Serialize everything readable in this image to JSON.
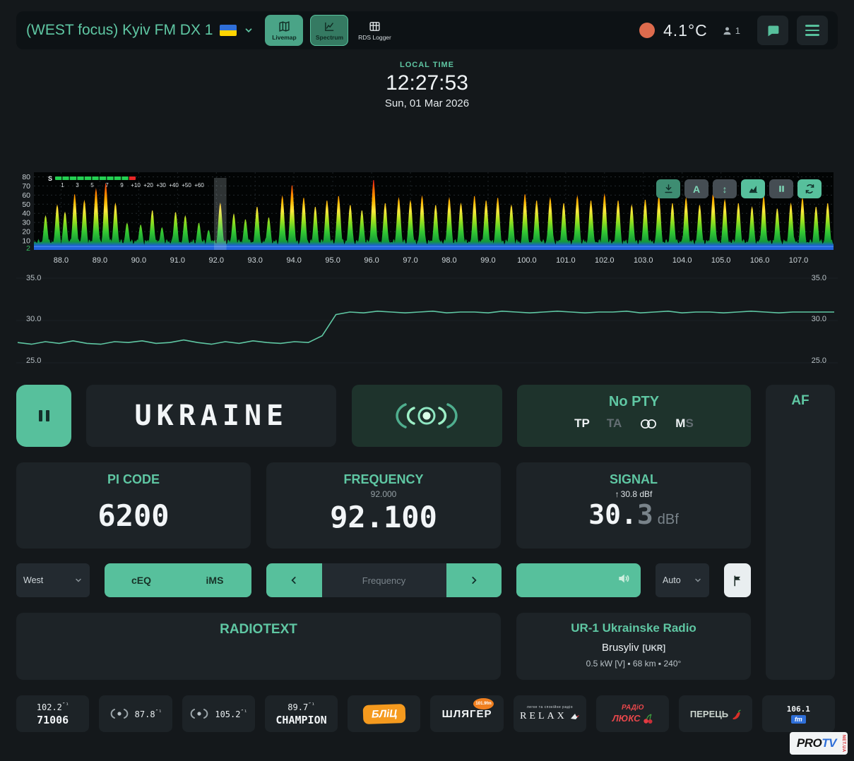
{
  "theme": {
    "accent": "#57c09c",
    "background": "#14181b",
    "panel": "#1d2327",
    "panel_green": "#1e332c",
    "spectrum_bg": "#020404",
    "history_line": "#5fc7a3"
  },
  "header": {
    "station_title": "(WEST focus) Kyiv FM DX 1",
    "flag_icon": "ukraine-flag",
    "nav": [
      {
        "label": "Livemap",
        "icon": "map-icon"
      },
      {
        "label": "Spectrum",
        "icon": "chart-icon"
      },
      {
        "label": "RDS Logger",
        "icon": "table-icon"
      }
    ],
    "temperature": "4.1°C",
    "listeners": "1"
  },
  "clock": {
    "label": "LOCAL TIME",
    "time": "12:27:53",
    "date": "Sun, 01 Mar 2026"
  },
  "chart_data": [
    {
      "type": "area",
      "name": "fm-band-spectrum",
      "x_range": [
        87.3,
        107.9
      ],
      "ylim": [
        0,
        85
      ],
      "x_ticks": [
        "88.0",
        "89.0",
        "90.0",
        "91.0",
        "92.0",
        "93.0",
        "94.0",
        "95.0",
        "96.0",
        "97.0",
        "98.0",
        "99.0",
        "100.0",
        "101.0",
        "102.0",
        "103.0",
        "104.0",
        "105.0",
        "106.0",
        "107.0"
      ],
      "y_ticks": [
        80,
        70,
        60,
        50,
        40,
        30,
        20,
        10,
        2
      ],
      "cursor_mhz": 92.1,
      "noise_floor": 7,
      "s_meter": {
        "label": "S",
        "ticks": [
          "1",
          "3",
          "5",
          "7",
          "9",
          "+10",
          "+20",
          "+30",
          "+40",
          "+50",
          "+60"
        ]
      },
      "peaks": [
        [
          87.6,
          38
        ],
        [
          87.9,
          50
        ],
        [
          88.1,
          42
        ],
        [
          88.35,
          62
        ],
        [
          88.6,
          55
        ],
        [
          88.9,
          68
        ],
        [
          89.15,
          74
        ],
        [
          89.4,
          52
        ],
        [
          89.7,
          30
        ],
        [
          90.05,
          28
        ],
        [
          90.35,
          44
        ],
        [
          90.6,
          25
        ],
        [
          90.95,
          42
        ],
        [
          91.2,
          38
        ],
        [
          91.55,
          30
        ],
        [
          91.8,
          22
        ],
        [
          92.1,
          52
        ],
        [
          92.45,
          40
        ],
        [
          92.75,
          34
        ],
        [
          93.05,
          48
        ],
        [
          93.35,
          36
        ],
        [
          93.7,
          60
        ],
        [
          93.95,
          72
        ],
        [
          94.25,
          58
        ],
        [
          94.55,
          48
        ],
        [
          94.85,
          55
        ],
        [
          95.15,
          60
        ],
        [
          95.45,
          50
        ],
        [
          95.75,
          44
        ],
        [
          96.05,
          78
        ],
        [
          96.35,
          52
        ],
        [
          96.7,
          58
        ],
        [
          97.0,
          55
        ],
        [
          97.3,
          60
        ],
        [
          97.65,
          50
        ],
        [
          98.0,
          58
        ],
        [
          98.3,
          52
        ],
        [
          98.65,
          60
        ],
        [
          98.95,
          55
        ],
        [
          99.25,
          58
        ],
        [
          99.6,
          50
        ],
        [
          99.95,
          62
        ],
        [
          100.25,
          55
        ],
        [
          100.6,
          58
        ],
        [
          100.95,
          52
        ],
        [
          101.3,
          60
        ],
        [
          101.65,
          55
        ],
        [
          102.0,
          62
        ],
        [
          102.35,
          55
        ],
        [
          102.7,
          50
        ],
        [
          103.05,
          56
        ],
        [
          103.4,
          60
        ],
        [
          103.75,
          52
        ],
        [
          104.1,
          58
        ],
        [
          104.45,
          50
        ],
        [
          104.8,
          64
        ],
        [
          105.1,
          56
        ],
        [
          105.45,
          52
        ],
        [
          105.8,
          48
        ],
        [
          106.1,
          60
        ],
        [
          106.45,
          46
        ],
        [
          106.8,
          52
        ],
        [
          107.1,
          58
        ],
        [
          107.45,
          48
        ],
        [
          107.75,
          52
        ]
      ]
    },
    {
      "type": "line",
      "name": "signal-history",
      "ylim": [
        25,
        35
      ],
      "y_ticks": [
        "35.0",
        "30.0",
        "25.0"
      ],
      "values": [
        27.4,
        27.2,
        27.5,
        27.3,
        27.6,
        27.3,
        27.2,
        27.5,
        27.4,
        27.6,
        27.3,
        27.4,
        27.7,
        27.4,
        27.2,
        27.5,
        27.3,
        27.6,
        27.4,
        27.3,
        27.5,
        27.4,
        28.2,
        30.7,
        31.0,
        30.9,
        31.1,
        31.0,
        30.9,
        31.0,
        31.1,
        30.9,
        31.0,
        31.0,
        30.9,
        31.1,
        31.0,
        30.9,
        31.0,
        31.1,
        31.0,
        30.9,
        31.0,
        31.0,
        31.1,
        30.9,
        31.0,
        31.1,
        30.9,
        31.0,
        31.0,
        30.9,
        31.0,
        31.1,
        31.0,
        30.9,
        31.0,
        31.0,
        31.0,
        31.0
      ]
    }
  ],
  "spectrum_controls": {
    "autoscale_label": "A",
    "vscale_label": "↕"
  },
  "station": {
    "ps": "UKRAINE",
    "pty": "No PTY",
    "tp": "TP",
    "ta": "TA",
    "m": "M",
    "s": "S",
    "af_label": "AF"
  },
  "panels": {
    "pi": {
      "label": "PI CODE",
      "value": "6200"
    },
    "freq": {
      "label": "FREQUENCY",
      "sub": "92.000",
      "value": "92.100"
    },
    "signal": {
      "label": "SIGNAL",
      "peak_arrow": "↑",
      "peak": "30.8 dBf",
      "value_int": "30.",
      "value_frac": "3",
      "unit": "dBf"
    }
  },
  "controls": {
    "antenna": "West",
    "eq": "cEQ",
    "ims": "iMS",
    "tune_placeholder": "Frequency",
    "mode": "Auto"
  },
  "radiotext": {
    "label": "RADIOTEXT",
    "text": ""
  },
  "tx_info": {
    "name": "UR-1 Ukrainske Radio",
    "city": "Brusyliv",
    "country": "[UKR]",
    "details": "0.5 kW [V] ▪ 68 km ▪ 240°"
  },
  "presets": [
    {
      "freq": "102.2",
      "sup": "″¹",
      "code": "71006"
    },
    {
      "freq": "87.8",
      "sup": "″¹"
    },
    {
      "freq": "105.2",
      "sup": "″¹"
    },
    {
      "freq": "89.7",
      "sup": "″¹",
      "name": "CHAMPION"
    },
    {
      "logo": "БЛіЦ"
    },
    {
      "logo": "ШЛЯГЕР",
      "badge": "101.9fm"
    },
    {
      "logo": "RELAX",
      "tagline": "легке та спокійне радіо"
    },
    {
      "logo_top": "РАДіО",
      "logo_bottom": "ЛЮКС"
    },
    {
      "logo": "ПЕРЕЦЬ"
    },
    {
      "logo": "106.1",
      "unit": "fm"
    }
  ],
  "watermark": {
    "pro": "PRO",
    "tv": "TV",
    "side": "NET.UA"
  }
}
